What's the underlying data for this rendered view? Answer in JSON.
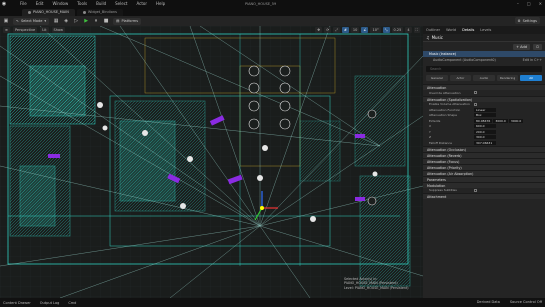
{
  "app": {
    "title": "PIANO_HOUSE_59",
    "menu": [
      "File",
      "Edit",
      "Window",
      "Tools",
      "Build",
      "Select",
      "Actor",
      "Help"
    ],
    "window_controls": [
      "minimize-icon",
      "maximize-icon",
      "close-icon"
    ]
  },
  "tabs": [
    {
      "label": "PIANO_HOUSE_MAIN",
      "active": true
    },
    {
      "label": "Widget_Bindions",
      "active": false
    }
  ],
  "toolbar": {
    "mode_label": "Select Mode",
    "platforms_label": "Platforms",
    "settings_label": "Settings"
  },
  "viewport": {
    "perspective_label": "Perspective",
    "lit_label": "Lit",
    "show_label": "Show",
    "snap_values": [
      "10",
      "10°",
      "0.25"
    ],
    "camera_speed": "4",
    "overlay": {
      "line1": "Selected Actor(s) in:",
      "line2": "PIANO_HOUSE_MAIN (Persistent)",
      "line3": "Level: PIANO_HOUSE_MAIN (Persistent)"
    }
  },
  "outliner": {
    "tabs": [
      "Outliner",
      "World",
      "Details",
      "Levels"
    ],
    "actor_name": "Music",
    "add_label": "+ Add",
    "components": [
      {
        "label": "Music (Instance)",
        "selected": true
      },
      {
        "label": "AudioComponent (AudioComponent0)",
        "selected": false,
        "extra": "Edit in C++"
      }
    ],
    "search_placeholder": "Search",
    "filter_tabs": [
      "General",
      "Actor",
      "Audio",
      "Rendering",
      "All"
    ],
    "active_filter": "All"
  },
  "details": {
    "sections": [
      {
        "title": "Attenuation"
      },
      {
        "title": "Attenuation (Spatialization)"
      },
      {
        "title": "Attenuation (Occlusion)"
      },
      {
        "title": "Attenuation (Reverb)"
      },
      {
        "title": "Attenuation (Focus)"
      },
      {
        "title": "Attenuation (Priority)"
      },
      {
        "title": "Attenuation (Air Absorption)"
      },
      {
        "title": "Parameters"
      },
      {
        "title": "Modulation"
      },
      {
        "title": "Attachment"
      }
    ],
    "props": {
      "override_attenuation": "Override Attenuation",
      "enable_volume": "Enable Volume Attenuation",
      "function_label": "Attenuation Function",
      "function_value": "Linear",
      "shape_label": "Attenuation Shape",
      "shape_value": "Box",
      "extents_label": "Extents",
      "extents_values": [
        "80.08476",
        "3000.0",
        "3000.0"
      ],
      "x_label": "X",
      "x_value": "600.0",
      "y_label": "Y",
      "y_value": "200.0",
      "z_label": "Z",
      "z_value": "300.0",
      "falloff_label": "Falloff Distance",
      "falloff_value": "307.06631",
      "suspend_label": "Suppress Subtitles"
    }
  },
  "statusbar": {
    "items": [
      "Content Drawer",
      "Output Log",
      "Cmd"
    ],
    "right_items": [
      "Derived Data",
      "Source Control Off"
    ]
  },
  "colors": {
    "viewport_bg": "#1a1d1c",
    "wireframe": "#2fd0c0",
    "purple": "#8a2be2",
    "accent_blue": "#1f7fd1"
  }
}
